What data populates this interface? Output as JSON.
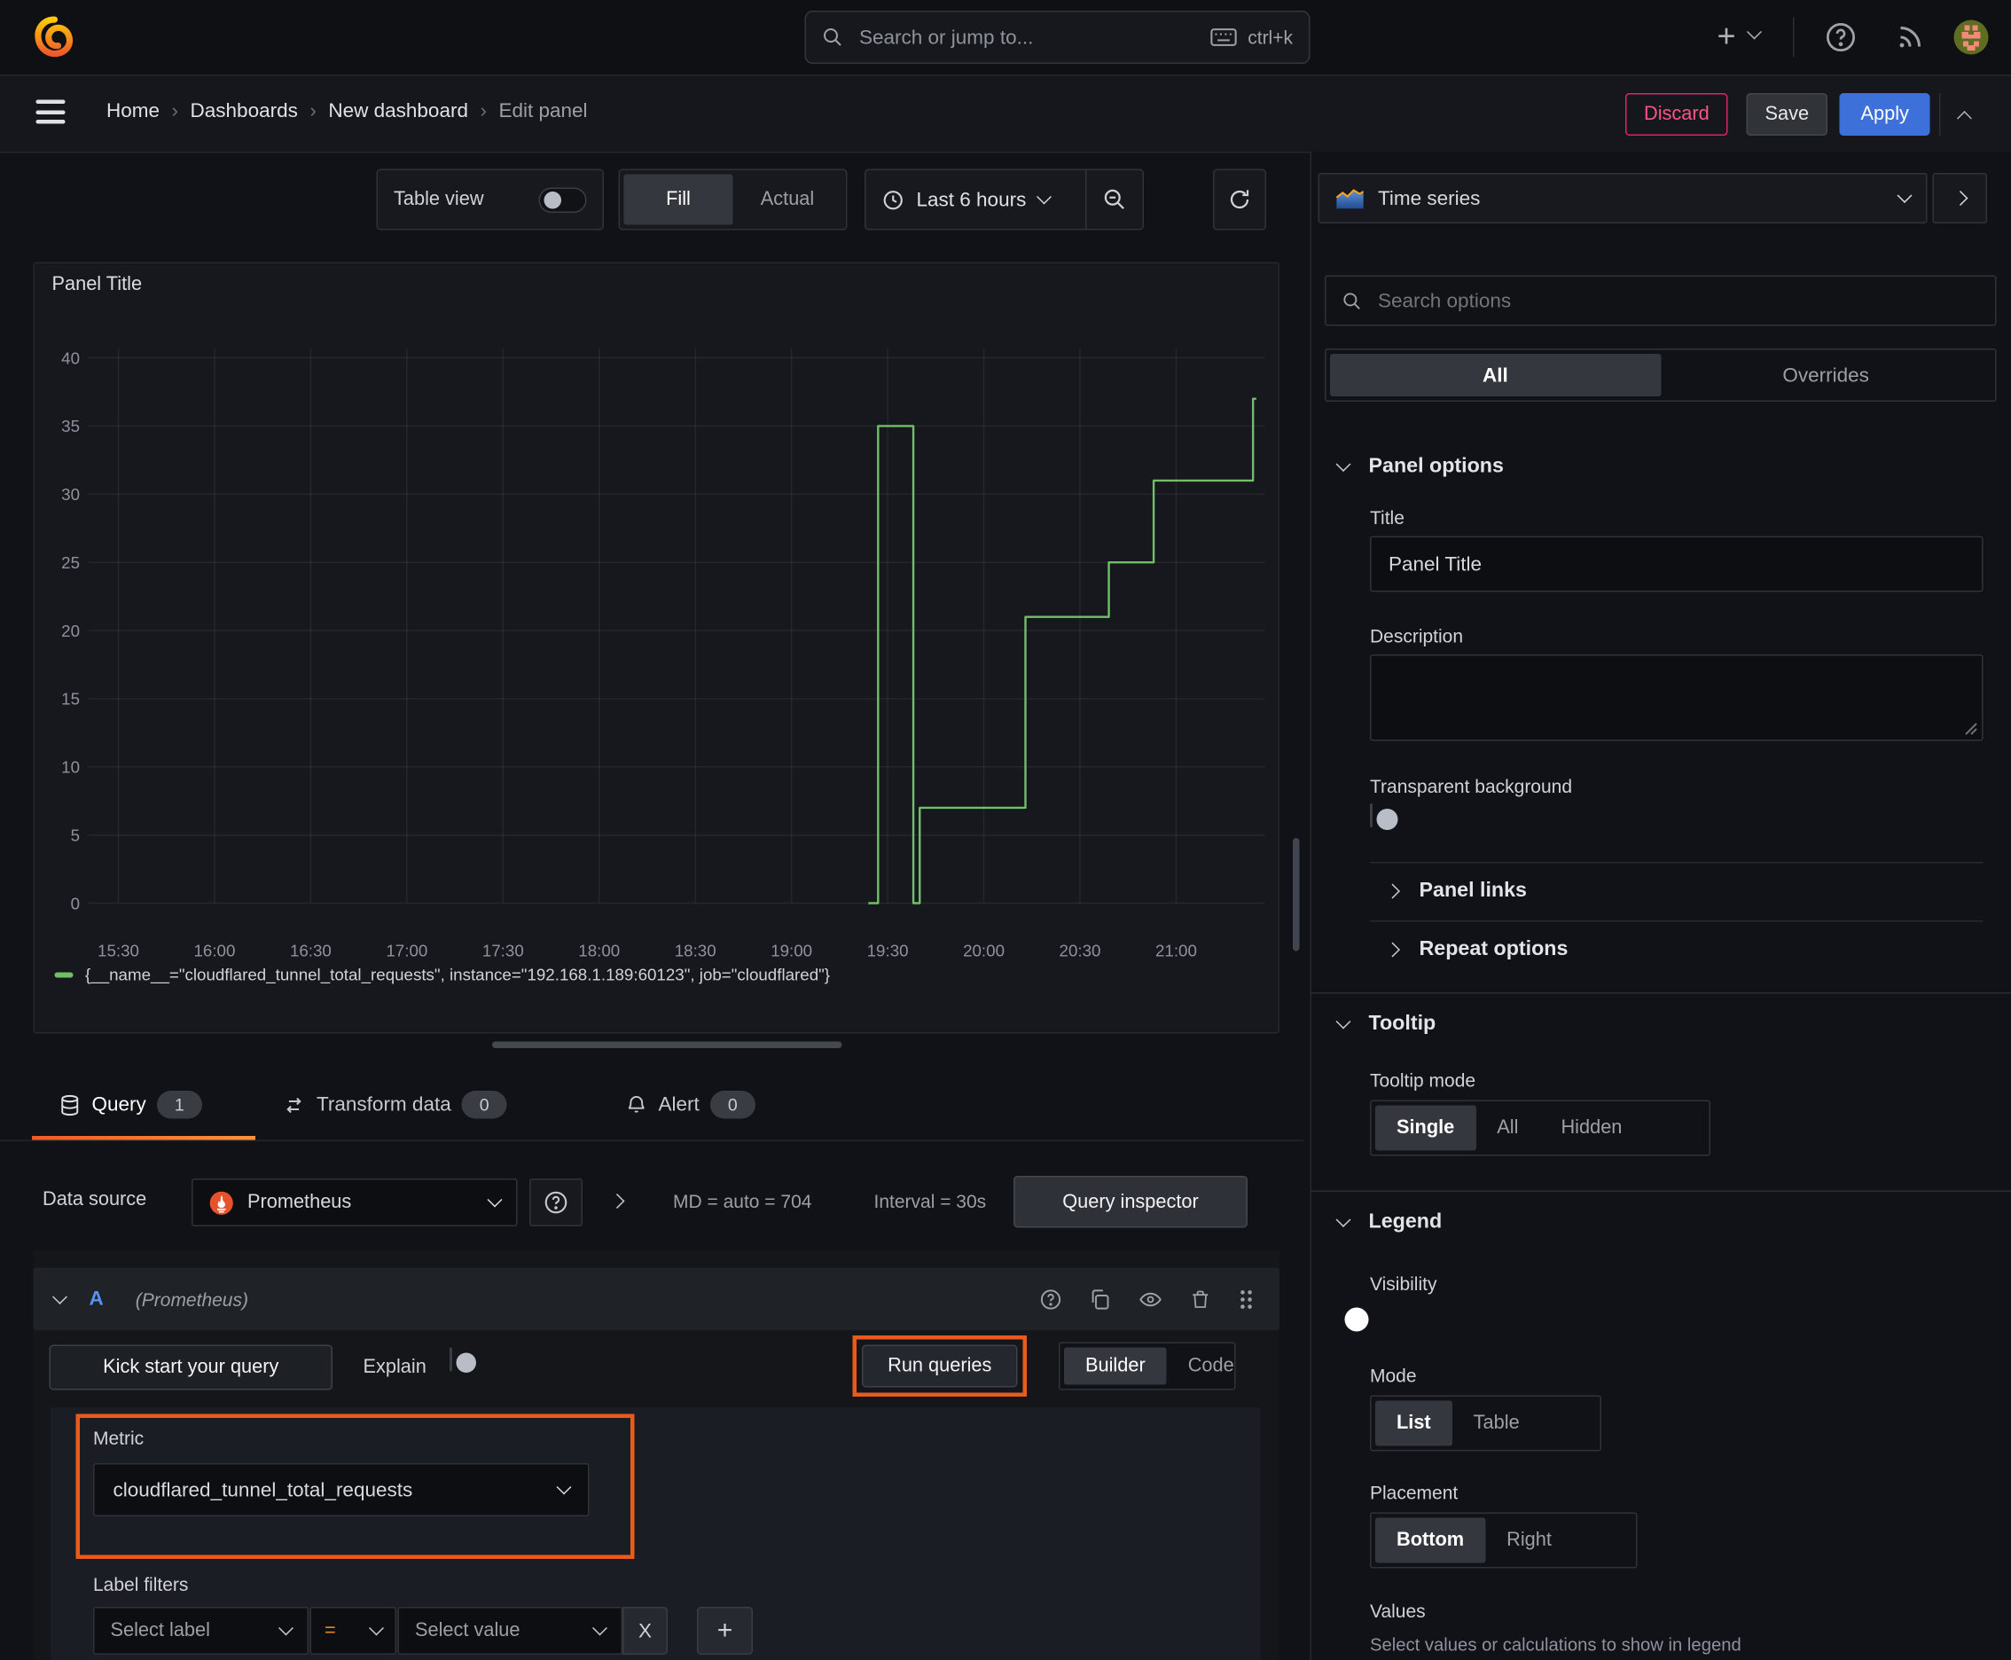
{
  "topbar": {
    "search_placeholder": "Search or jump to...",
    "shortcut": "ctrl+k"
  },
  "breadcrumb": {
    "items": [
      "Home",
      "Dashboards",
      "New dashboard",
      "Edit panel"
    ],
    "separator": "›"
  },
  "actions": {
    "discard": "Discard",
    "save": "Save",
    "apply": "Apply"
  },
  "toolbar": {
    "table_view": "Table view",
    "fill": "Fill",
    "actual": "Actual",
    "time_range": "Last 6 hours"
  },
  "panel": {
    "title": "Panel Title"
  },
  "chart_data": {
    "type": "line",
    "title": "Panel Title",
    "x_ticks": [
      "15:30",
      "16:00",
      "16:30",
      "17:00",
      "17:30",
      "18:00",
      "18:30",
      "19:00",
      "19:30",
      "20:00",
      "20:30",
      "21:00"
    ],
    "y_ticks": [
      0,
      5,
      10,
      15,
      20,
      25,
      30,
      35,
      40
    ],
    "ylim": [
      0,
      40
    ],
    "xlabel": "",
    "ylabel": "",
    "grid": true,
    "legend_position": "bottom",
    "series": [
      {
        "name": "{__name__=\"cloudflared_tunnel_total_requests\", instance=\"192.168.1.189:60123\", job=\"cloudflared\"}",
        "color": "#73BF69",
        "step_points": [
          [
            "19:24",
            0
          ],
          [
            "19:27",
            0
          ],
          [
            "19:27",
            35
          ],
          [
            "19:38",
            35
          ],
          [
            "19:38",
            0
          ],
          [
            "19:40",
            0
          ],
          [
            "19:40",
            7
          ],
          [
            "20:13",
            7
          ],
          [
            "20:13",
            21
          ],
          [
            "20:39",
            21
          ],
          [
            "20:39",
            25
          ],
          [
            "20:53",
            25
          ],
          [
            "20:53",
            31
          ],
          [
            "21:24",
            31
          ],
          [
            "21:24",
            37
          ],
          [
            "21:25",
            37
          ]
        ]
      }
    ]
  },
  "tabs": {
    "query": {
      "label": "Query",
      "badge": "1"
    },
    "transform": {
      "label": "Transform data",
      "badge": "0"
    },
    "alert": {
      "label": "Alert",
      "badge": "0"
    }
  },
  "datasource": {
    "label": "Data source",
    "name": "Prometheus",
    "md": "MD = auto = 704",
    "interval": "Interval = 30s",
    "inspector": "Query inspector"
  },
  "query": {
    "ref": "A",
    "ds": "(Prometheus)",
    "kick_start": "Kick start your query",
    "explain": "Explain",
    "run": "Run queries",
    "builder": "Builder",
    "code": "Code",
    "metric_label": "Metric",
    "metric_value": "cloudflared_tunnel_total_requests",
    "label_filters": "Label filters",
    "select_label": "Select label",
    "operator": "=",
    "select_value": "Select value",
    "remove": "X",
    "add": "+"
  },
  "options": {
    "viz": "Time series",
    "search_placeholder": "Search options",
    "tab_all": "All",
    "tab_overrides": "Overrides",
    "panel_options": {
      "title": "Panel options",
      "title_label": "Title",
      "title_value": "Panel Title",
      "description_label": "Description",
      "transparent_label": "Transparent background",
      "panel_links": "Panel links",
      "repeat_options": "Repeat options"
    },
    "tooltip": {
      "title": "Tooltip",
      "mode_label": "Tooltip mode",
      "single": "Single",
      "all": "All",
      "hidden": "Hidden"
    },
    "legend": {
      "title": "Legend",
      "visibility": "Visibility",
      "mode": "Mode",
      "list": "List",
      "table": "Table",
      "placement": "Placement",
      "bottom": "Bottom",
      "right": "Right",
      "values": "Values",
      "values_hint": "Select values or calculations to show in legend"
    }
  },
  "colors": {
    "accent_orange": "#EA5A1D",
    "apply_blue": "#3D71D9",
    "discard_pink": "#E0226E",
    "series_green": "#73BF69",
    "ref_blue": "#5794F2",
    "prometheus_orange": "#E6522C"
  }
}
